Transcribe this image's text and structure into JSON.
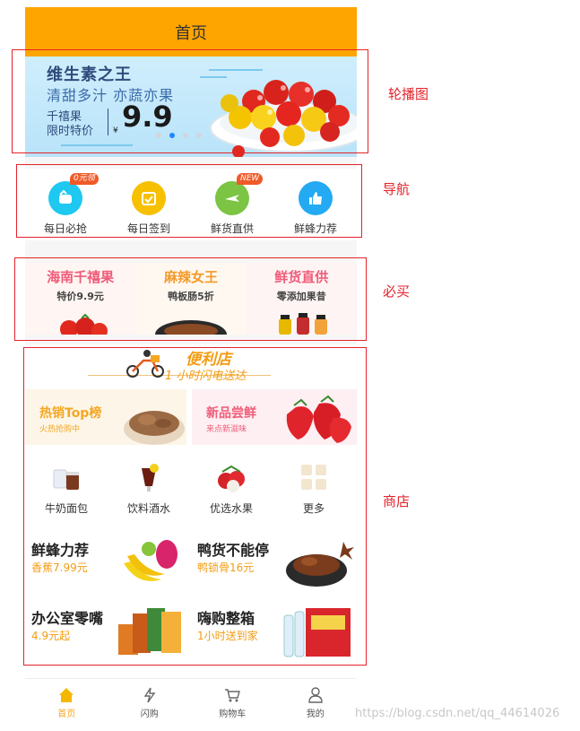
{
  "header": {
    "title": "首页"
  },
  "banner": {
    "title": "维生素之王",
    "subtitle": "清甜多汁 亦蔬亦果",
    "line1": "千禧果",
    "line2": "限时特价",
    "currency": "¥",
    "price": "9.9",
    "dots": 4,
    "active_dot": 1
  },
  "nav": {
    "items": [
      {
        "label": "每日必抢",
        "icon": "fist-icon",
        "color": "#1ec8f0",
        "badge": "0元领"
      },
      {
        "label": "每日签到",
        "icon": "calendar-check-icon",
        "color": "#f7c000",
        "badge": ""
      },
      {
        "label": "鲜货直供",
        "icon": "airplane-icon",
        "color": "#7cc443",
        "badge": "NEW"
      },
      {
        "label": "鲜蜂力荐",
        "icon": "thumbs-up-icon",
        "color": "#23aaf2",
        "badge": ""
      }
    ]
  },
  "mustbuy": {
    "items": [
      {
        "title": "海南千禧果",
        "subtitle": "特价9.9元",
        "color": "#f05c7a",
        "bg": "#fff5f2"
      },
      {
        "title": "麻辣女王",
        "subtitle": "鸭板肠5折",
        "color": "#f39a2a",
        "bg": "#fff8f0"
      },
      {
        "title": "鲜货直供",
        "subtitle": "零添加果昔",
        "color": "#f05c7a",
        "bg": "#fff4f4"
      }
    ]
  },
  "shop": {
    "title": "便利店",
    "subtitle": "1 小时闪电送达",
    "promos": [
      {
        "title": "热销Top榜",
        "subtitle": "火热抢购中",
        "color": "#f5a623",
        "bg": "#fdf6e8"
      },
      {
        "title": "新品尝鲜",
        "subtitle": "来点新滋味",
        "color": "#f05c7a",
        "bg": "#fdeff2"
      }
    ],
    "categories": [
      {
        "label": "牛奶面包",
        "icon": "milk-tea-icon"
      },
      {
        "label": "饮料酒水",
        "icon": "cocktail-icon"
      },
      {
        "label": "优选水果",
        "icon": "lychee-icon"
      },
      {
        "label": "更多",
        "icon": "grid-icon"
      }
    ],
    "features": [
      {
        "title": "鲜蜂力荐",
        "subtitle": "香蕉7.99元"
      },
      {
        "title": "鸭货不能停",
        "subtitle": "鸭锁骨16元"
      },
      {
        "title": "办公室零嘴",
        "subtitle": "4.9元起"
      },
      {
        "title": "嗨购整箱",
        "subtitle": "1小时送到家"
      }
    ]
  },
  "tabbar": {
    "items": [
      {
        "label": "首页",
        "icon": "home-icon",
        "active": true
      },
      {
        "label": "闪购",
        "icon": "flash-icon",
        "active": false
      },
      {
        "label": "购物车",
        "icon": "cart-icon",
        "active": false
      },
      {
        "label": "我的",
        "icon": "user-icon",
        "active": false
      }
    ]
  },
  "annotations": {
    "banner": "轮播图",
    "nav": "导航",
    "mustbuy": "必买",
    "shop": "商店"
  },
  "watermark": "https://blog.csdn.net/qq_44614026",
  "colors": {
    "accent": "#ffa500",
    "annotation": "#e3232b",
    "price": "#f39c12"
  }
}
